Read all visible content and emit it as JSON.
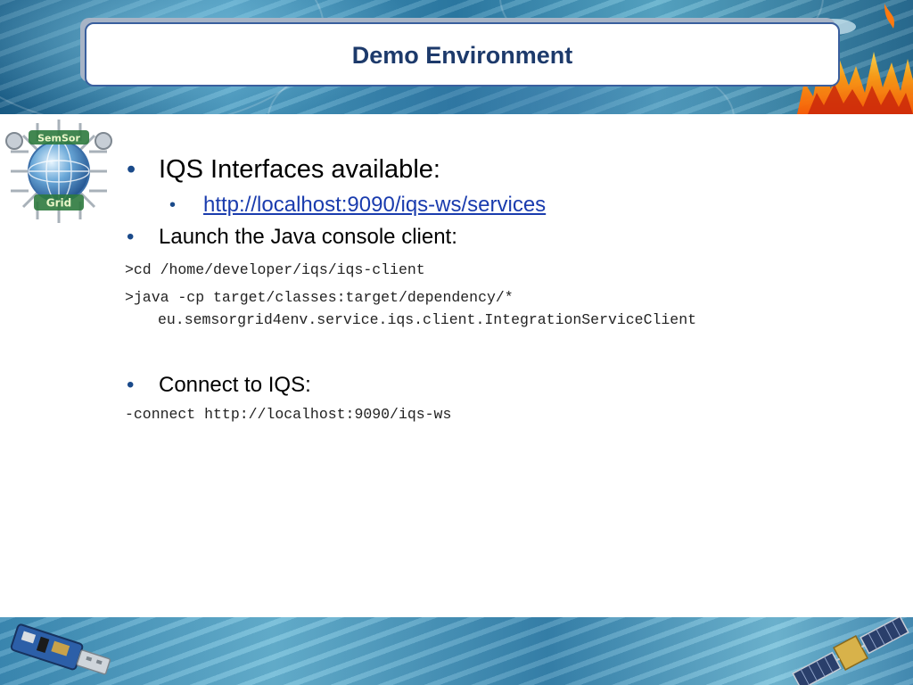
{
  "slide": {
    "title": "Demo Environment"
  },
  "content": {
    "bullet1": "IQS Interfaces available:",
    "bullet1_sub_link": "http://localhost:9090/iqs-ws/services",
    "bullet2": "Launch the Java console client:",
    "code1": ">cd /home/developer/iqs/iqs-client",
    "code2_line1": ">java -cp target/classes:target/dependency/*",
    "code2_line2": "eu.semsorgrid4env.service.iqs.client.IntegrationServiceClient",
    "bullet3": "Connect to IQS:",
    "code3": "-connect http://localhost:9090/iqs-ws"
  },
  "bullet_glyph": "•",
  "logo": {
    "text_top": "SemSor",
    "text_bottom": "Grid",
    "icon": "semsorgrid-globe-logo"
  },
  "colors": {
    "title_text": "#1d3a6b",
    "title_border": "#3a5f9e",
    "link": "#1a3cae",
    "bullet": "#1a4a8a"
  }
}
